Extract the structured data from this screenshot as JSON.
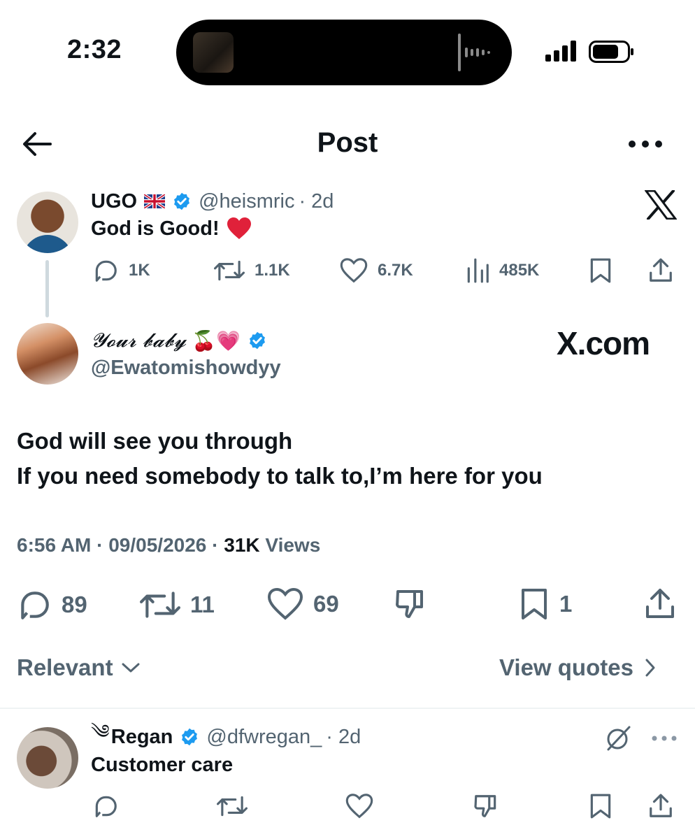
{
  "status_bar": {
    "time": "2:32"
  },
  "header": {
    "title": "Post"
  },
  "parent_tweet": {
    "name": "UGO",
    "flag": "🇬🇧",
    "handle": "@heismric",
    "age": "· 2d",
    "text": "God is Good!",
    "stats": {
      "replies": "1K",
      "reposts": "1.1K",
      "likes": "6.7K",
      "views": "485K"
    }
  },
  "watermarks": {
    "x_com": "X.com"
  },
  "main_tweet": {
    "display_name": "𝓨𝓸𝓾𝓻 𝓫𝓪𝓫𝔂",
    "emoji": "🍒💗",
    "handle": "@Ewatomishowdyy",
    "line1": "God will see you through",
    "line2": "If you need somebody to talk to,I’m here for you",
    "time": "6:56 AM",
    "date": "09/05/2026",
    "views_count": "31K",
    "views_label": "Views",
    "stats": {
      "replies": "89",
      "reposts": "11",
      "likes": "69",
      "bookmarks": "1"
    }
  },
  "sort": {
    "relevant": "Relevant",
    "view_quotes": "View quotes"
  },
  "reply": {
    "prefix": "༄",
    "name": "Regan",
    "handle": "@dfwregan_",
    "age": "· 2d",
    "text": "Customer care"
  },
  "colors": {
    "text": "#0f1419",
    "secondary": "#536471",
    "verified": "#1d9bf0",
    "heart": "#e0245e"
  }
}
